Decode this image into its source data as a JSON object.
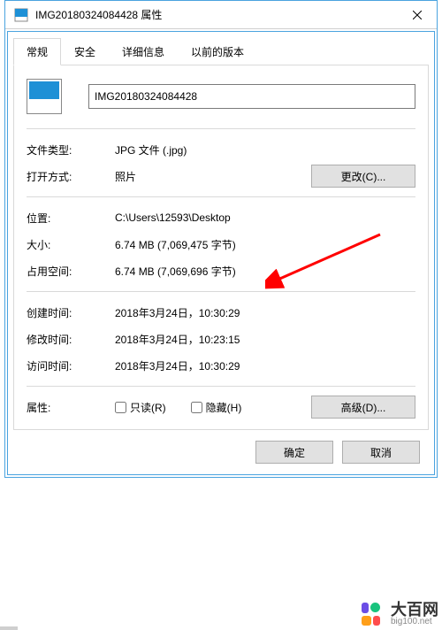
{
  "titlebar": {
    "title": "IMG20180324084428 属性"
  },
  "tabs": {
    "general": "常规",
    "security": "安全",
    "details": "详细信息",
    "previous": "以前的版本"
  },
  "file": {
    "name": "IMG20180324084428"
  },
  "labels": {
    "filetype": "文件类型:",
    "opens_with": "打开方式:",
    "location": "位置:",
    "size": "大小:",
    "size_on_disk": "占用空间:",
    "created": "创建时间:",
    "modified": "修改时间:",
    "accessed": "访问时间:",
    "attributes": "属性:"
  },
  "values": {
    "filetype": "JPG 文件 (.jpg)",
    "opens_with": "照片",
    "location": "C:\\Users\\12593\\Desktop",
    "size": "6.74 MB (7,069,475 字节)",
    "size_on_disk": "6.74 MB (7,069,696 字节)",
    "created": "2018年3月24日，10:30:29",
    "modified": "2018年3月24日，10:23:15",
    "accessed": "2018年3月24日，10:30:29"
  },
  "buttons": {
    "change": "更改(C)...",
    "advanced": "高级(D)...",
    "ok": "确定",
    "cancel": "取消"
  },
  "checkboxes": {
    "readonly": "只读(R)",
    "hidden": "隐藏(H)"
  },
  "watermark": {
    "brand": "大百网",
    "url": "big100.net"
  },
  "colors": {
    "accent": "#4aa3df",
    "arrow": "#ff0000"
  }
}
